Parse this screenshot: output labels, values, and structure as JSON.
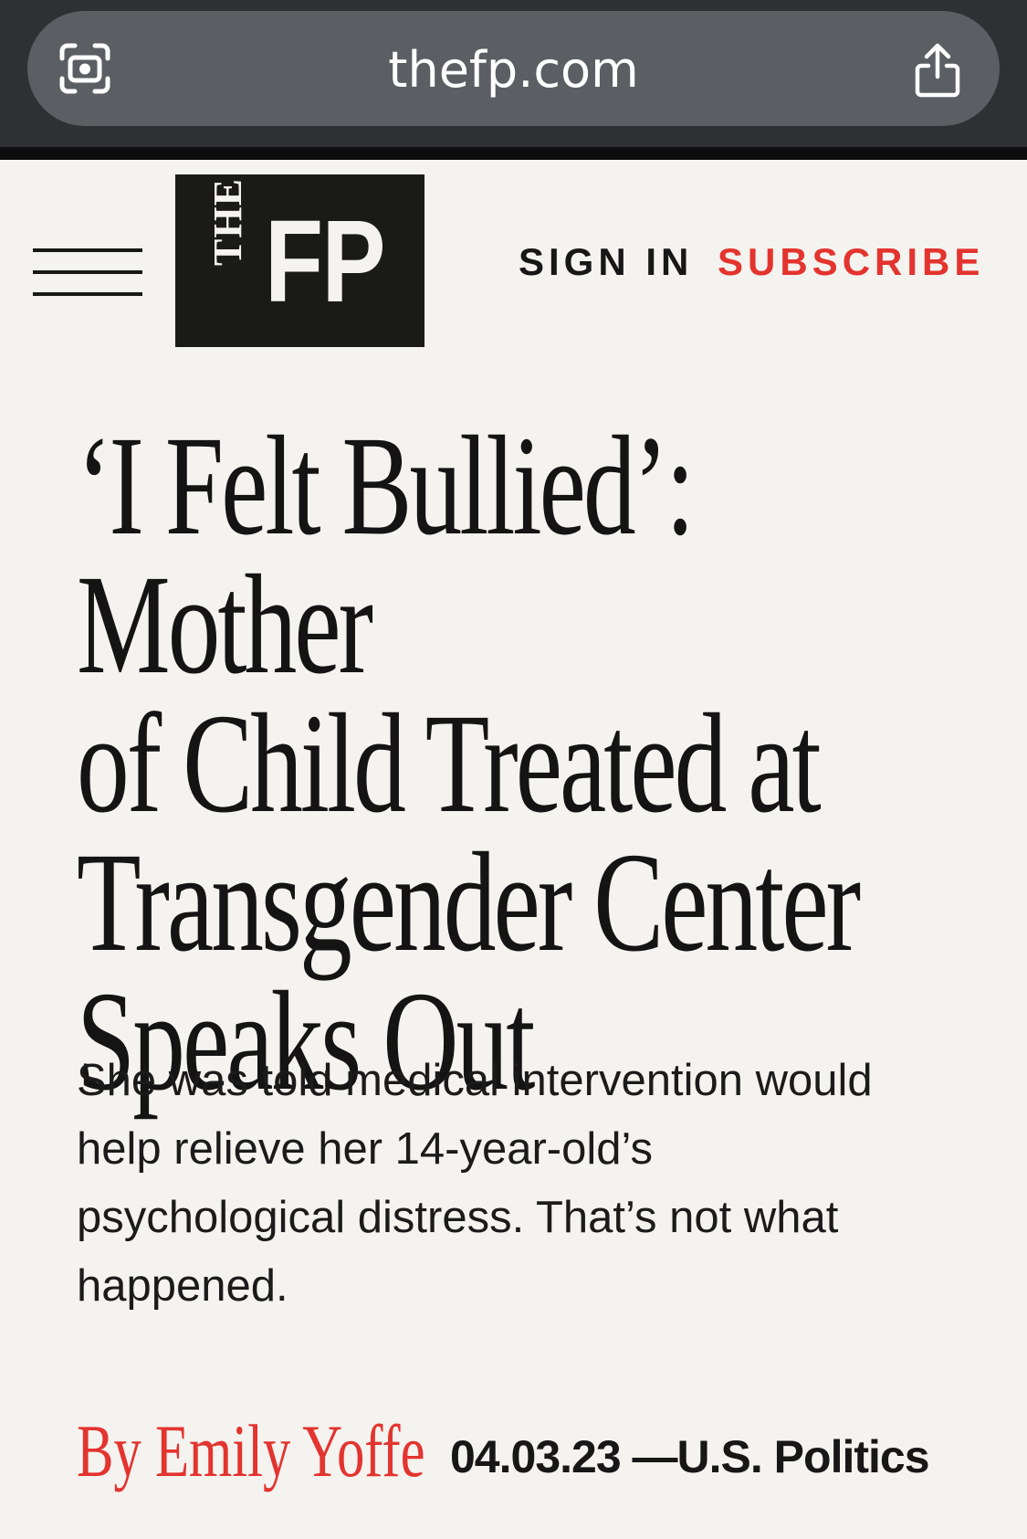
{
  "browser": {
    "url": "thefp.com",
    "left_icon": "visual-lookup-icon",
    "right_icon": "share-icon"
  },
  "header": {
    "menu_icon": "hamburger-menu-icon",
    "logo_the": "THE",
    "logo_fp": "FP",
    "sign_in": "SIGN IN",
    "subscribe": "SUBSCRIBE"
  },
  "article": {
    "headline_lines": [
      "‘I Felt Bullied’: Mother",
      "of Child Treated at",
      "Transgender Center",
      "Speaks Out"
    ],
    "dek_lines": [
      "She was told medical intervention would",
      "help relieve her 14-year-old’s",
      "psychological distress. That’s not what",
      "happened."
    ],
    "byline": "By Emily Yoffe",
    "date": "04.03.23",
    "separator": "—",
    "section": "U.S. Politics"
  },
  "colors": {
    "accent": "#e3342f",
    "background": "#f4f3ef",
    "text": "#171717",
    "chrome": "#2e3033"
  }
}
